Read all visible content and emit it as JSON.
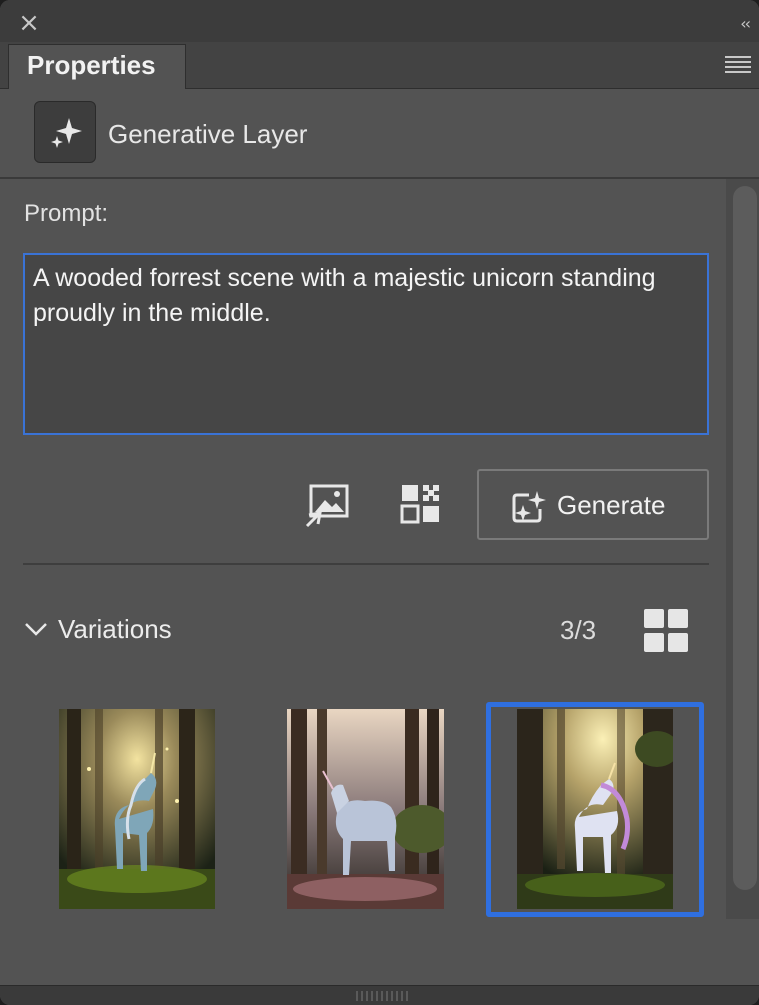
{
  "window": {
    "close_icon": "close-icon",
    "collapse_glyph": "‹‹"
  },
  "tab": {
    "label": "Properties"
  },
  "layer": {
    "title": "Generative Layer",
    "icon": "sparkle-icon"
  },
  "prompt": {
    "label": "Prompt:",
    "value": "A wooded forrest scene with a majestic unicorn standing proudly in the middle."
  },
  "toolbar": {
    "reference_image_icon": "reference-image-icon",
    "qr_icon": "grid-pattern-icon",
    "generate_label": "Generate"
  },
  "variations": {
    "label": "Variations",
    "count": "3/3",
    "selected_index": 2,
    "items": [
      {
        "name": "variation-1"
      },
      {
        "name": "variation-2"
      },
      {
        "name": "variation-3"
      }
    ]
  },
  "colors": {
    "panel_bg": "#535353",
    "accent_blue": "#2f6fe0",
    "text": "#e6e6e6"
  }
}
